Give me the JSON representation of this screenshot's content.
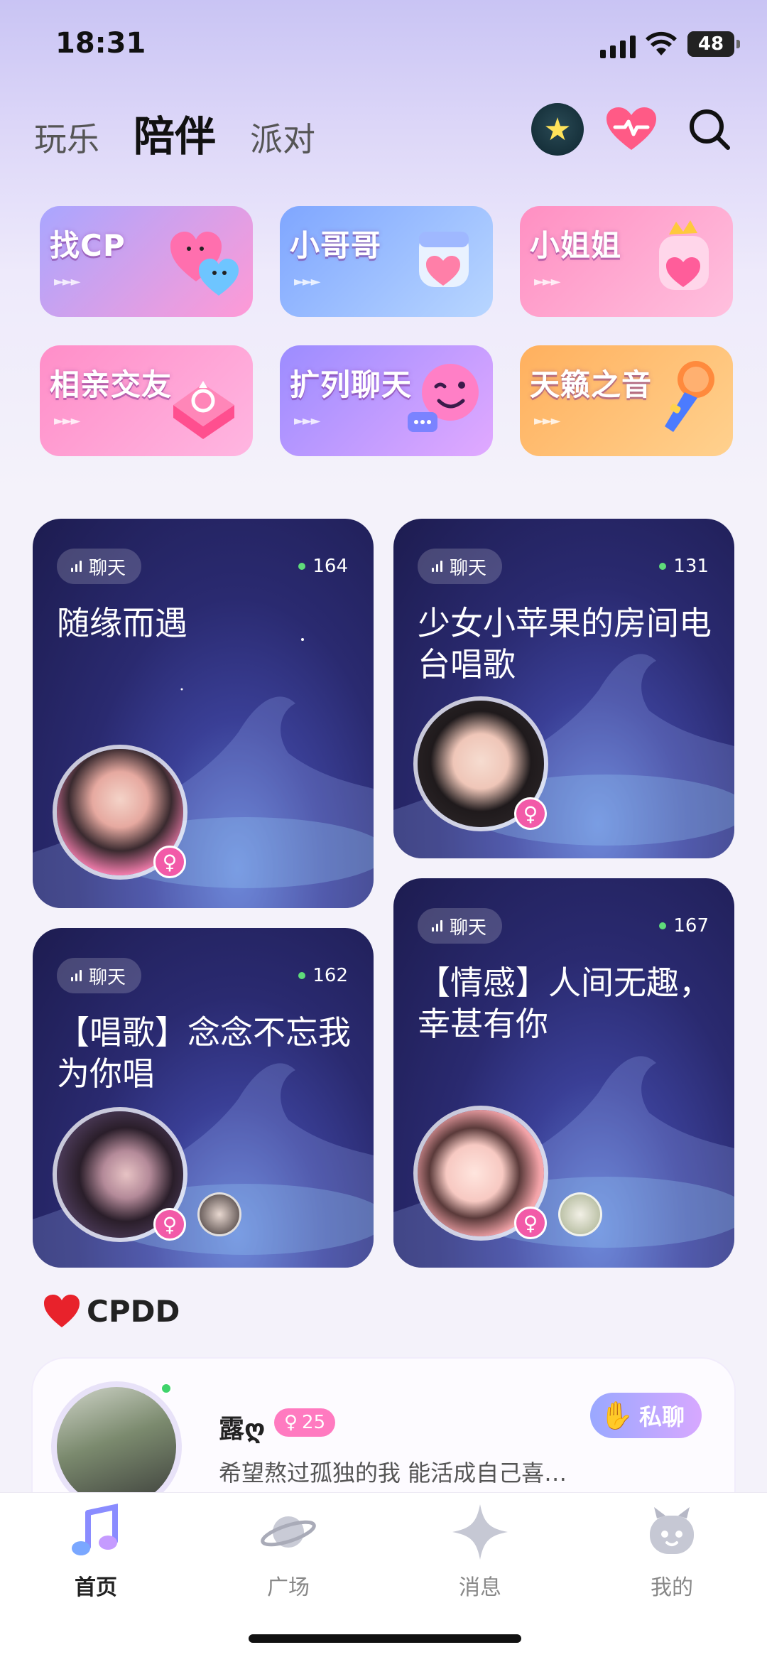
{
  "status": {
    "time": "18:31",
    "battery": "48",
    "battery_level": 0.48
  },
  "tabs": [
    {
      "label": "玩乐",
      "active": false
    },
    {
      "label": "陪伴",
      "active": true
    },
    {
      "label": "派对",
      "active": false
    }
  ],
  "header_icons": [
    "star-icon",
    "heart-pulse-icon",
    "search-icon"
  ],
  "categories": [
    {
      "label": "找CP",
      "colors": [
        "#a9a6ff",
        "#ff9ad6"
      ],
      "deco": "hearts"
    },
    {
      "label": "小哥哥",
      "colors": [
        "#7fa6ff",
        "#b8d6ff"
      ],
      "deco": "boy"
    },
    {
      "label": "小姐姐",
      "colors": [
        "#ff8fc2",
        "#ffc0de"
      ],
      "deco": "girl"
    },
    {
      "label": "相亲交友",
      "colors": [
        "#ff8ec8",
        "#ffb6e1"
      ],
      "deco": "ring"
    },
    {
      "label": "扩列聊天",
      "colors": [
        "#9c8cff",
        "#e1a9ff"
      ],
      "deco": "chat"
    },
    {
      "label": "天籁之音",
      "colors": [
        "#ffb05e",
        "#ffd18e"
      ],
      "deco": "mic"
    }
  ],
  "rooms": [
    {
      "tag": "聊天",
      "count": "164",
      "title": "随缘而遇"
    },
    {
      "tag": "聊天",
      "count": "131",
      "title": "少女小苹果的房间电台唱歌"
    },
    {
      "tag": "聊天",
      "count": "162",
      "title": "【唱歌】念念不忘我为你唱"
    },
    {
      "tag": "聊天",
      "count": "167",
      "title": "【情感】人间无趣，幸甚有你"
    }
  ],
  "cpdd": {
    "section_title": "CPDD",
    "name": "露ღ",
    "age": "25",
    "bio": "希望熬过孤独的我 能活成自己喜…",
    "chat_label": "私聊"
  },
  "nav": [
    {
      "label": "首页",
      "icon": "music-note-icon",
      "active": true
    },
    {
      "label": "广场",
      "icon": "planet-icon",
      "active": false
    },
    {
      "label": "消息",
      "icon": "sparkle-icon",
      "active": false
    },
    {
      "label": "我的",
      "icon": "robot-face-icon",
      "active": false
    }
  ],
  "colors": {
    "accent_pink": "#f25aa8",
    "card_bg": "#2a2a70",
    "online_green": "#5fdc7a"
  }
}
